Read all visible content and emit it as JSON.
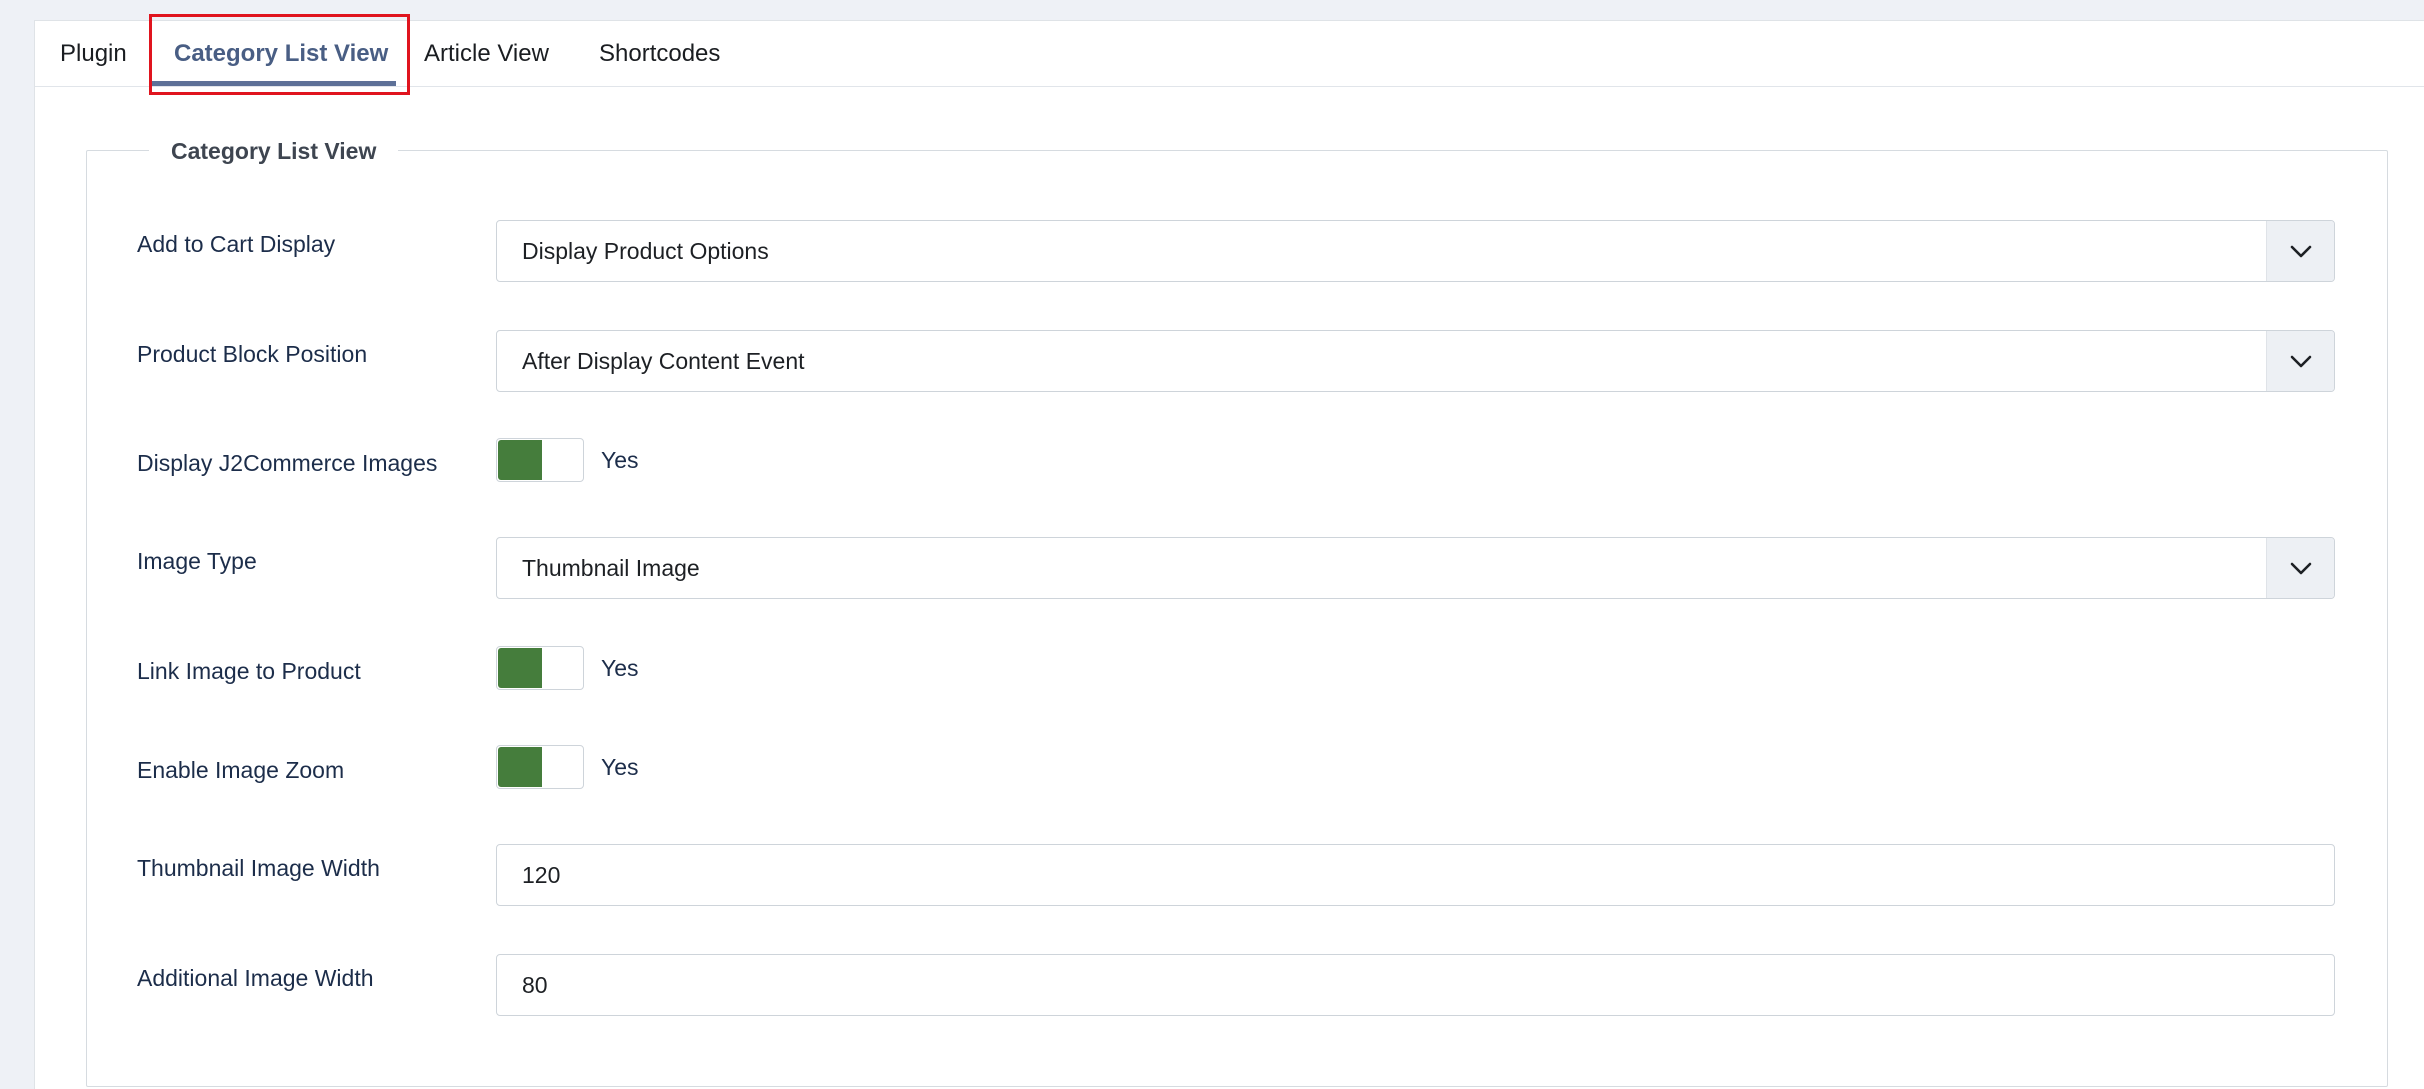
{
  "tabs": [
    {
      "label": "Plugin"
    },
    {
      "label": "Category List View"
    },
    {
      "label": "Article View"
    },
    {
      "label": "Shortcodes"
    }
  ],
  "fieldset": {
    "legend": "Category List View",
    "fields": {
      "add_to_cart_display": {
        "label": "Add to Cart Display",
        "value": "Display Product Options"
      },
      "product_block_position": {
        "label": "Product Block Position",
        "value": "After Display Content Event"
      },
      "display_images": {
        "label": "Display J2Commerce Images",
        "value": "Yes"
      },
      "image_type": {
        "label": "Image Type",
        "value": "Thumbnail Image"
      },
      "link_image": {
        "label": "Link Image to Product",
        "value": "Yes"
      },
      "image_zoom": {
        "label": "Enable Image Zoom",
        "value": "Yes"
      },
      "thumbnail_width": {
        "label": "Thumbnail Image Width",
        "value": "120"
      },
      "additional_width": {
        "label": "Additional Image Width",
        "value": "80"
      }
    }
  },
  "colors": {
    "active_tab": "#495e84",
    "toggle_on": "#457d3c",
    "highlight": "#e0141e"
  }
}
